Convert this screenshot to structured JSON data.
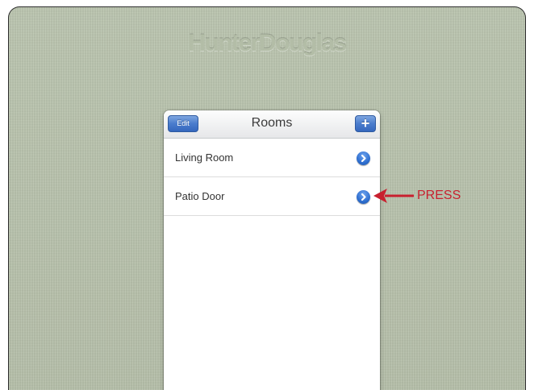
{
  "background": {
    "brand_text": "HunterDouglas",
    "fabric_color": "#b9c3ad"
  },
  "panel": {
    "navbar": {
      "edit_label": "Edit",
      "title": "Rooms",
      "add_label": "+"
    },
    "rooms": [
      {
        "label": "Living Room",
        "action_icon": "chevron-right-icon"
      },
      {
        "label": "Patio Door",
        "action_icon": "chevron-right-icon"
      }
    ],
    "accent_color": "#3a6fc8"
  },
  "annotation": {
    "text": "PRESS",
    "color": "#c8202f",
    "target": "Patio Door"
  }
}
